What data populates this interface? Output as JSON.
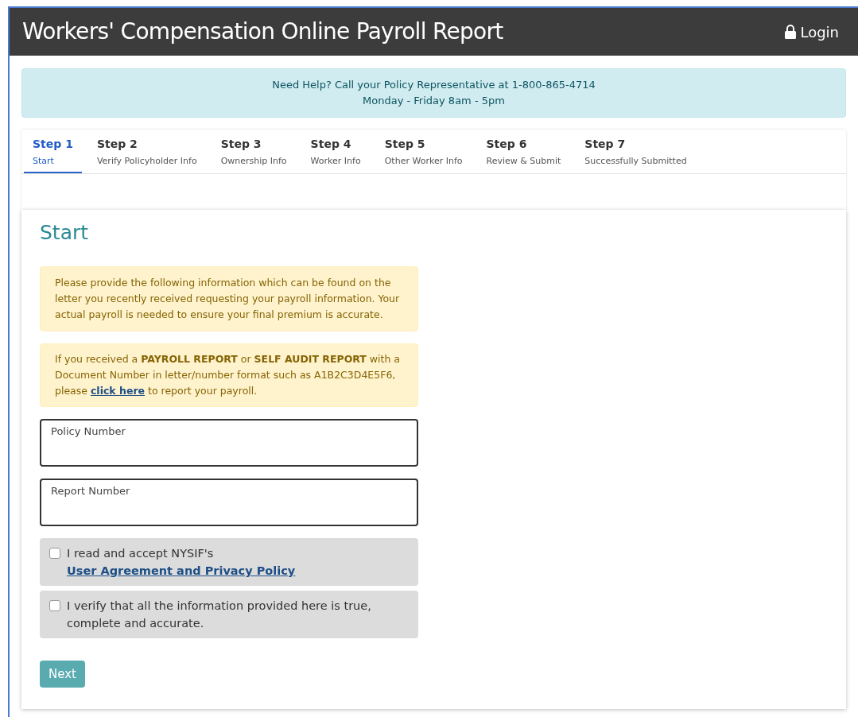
{
  "header": {
    "title": "Workers' Compensation Online Payroll Report",
    "login": "Login"
  },
  "help": {
    "line1": "Need Help? Call your Policy Representative at 1-800-865-4714",
    "line2": "Monday - Friday 8am - 5pm"
  },
  "steps": [
    {
      "step": "Step 1",
      "label": "Start",
      "selected": true
    },
    {
      "step": "Step 2",
      "label": "Verify Policyholder Info",
      "selected": false
    },
    {
      "step": "Step 3",
      "label": "Ownership Info",
      "selected": false
    },
    {
      "step": "Step 4",
      "label": "Worker Info",
      "selected": false
    },
    {
      "step": "Step 5",
      "label": "Other Worker Info",
      "selected": false
    },
    {
      "step": "Step 6",
      "label": "Review & Submit",
      "selected": false
    },
    {
      "step": "Step 7",
      "label": "Successfully Submitted",
      "selected": false
    }
  ],
  "form": {
    "title": "Start",
    "notice1": "Please provide the following information which can be found on the letter you recently received requesting your payroll information. Your actual payroll is needed to ensure your final premium is accurate.",
    "notice2": {
      "before": "If you received a **PAYROLL REPORT** or **SELF AUDIT REPORT** with a Document Number in letter/number format such as A1B2C3D4E5F6, please",
      "link": "click here",
      "after": "to report your payroll."
    },
    "fields": [
      {
        "label": "Policy Number"
      },
      {
        "label": "Report Number"
      }
    ],
    "checks": [
      {
        "text": "I read and accept NYSIF's",
        "link": "User Agreement and Privacy Policy",
        "checked": false
      },
      {
        "text": "I verify that all the information provided here is true, complete and accurate.",
        "checked": false
      }
    ],
    "next": "Next"
  }
}
